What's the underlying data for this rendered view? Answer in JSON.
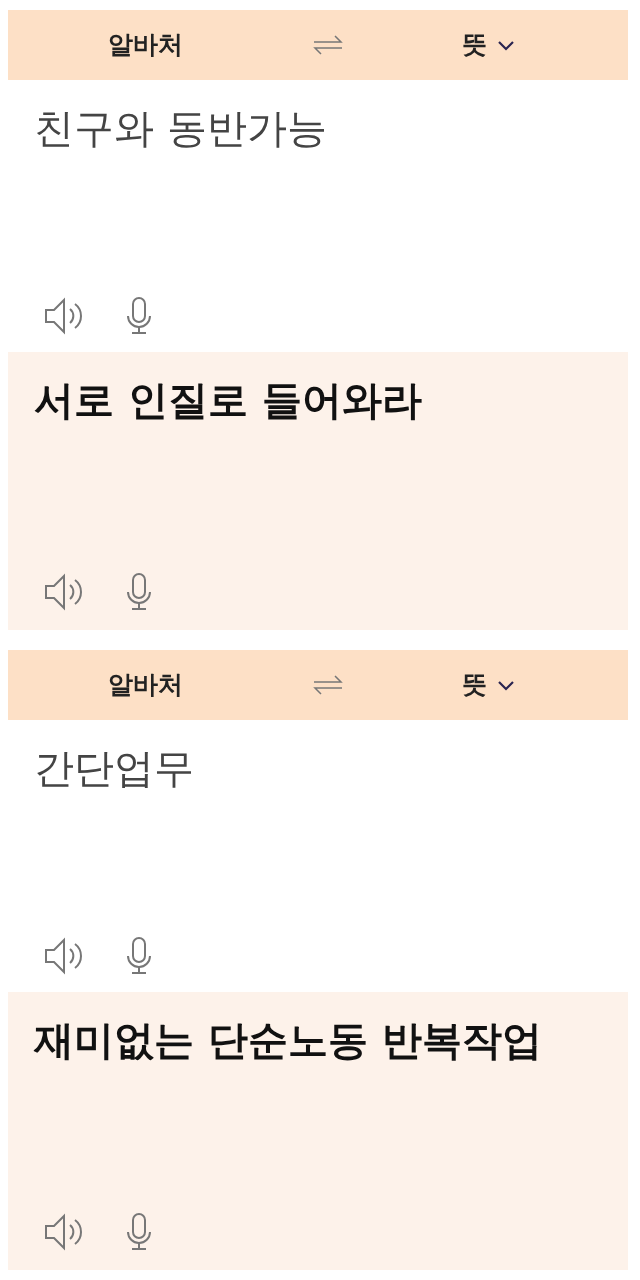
{
  "cards": [
    {
      "source_language": "알바처",
      "target_language": "뜻",
      "source_text": "친구와 동반가능",
      "target_text": "서로 인질로 들어와라"
    },
    {
      "source_language": "알바처",
      "target_language": "뜻",
      "source_text": "간단업무",
      "target_text": "재미없는 단순노동 반복작업"
    }
  ]
}
